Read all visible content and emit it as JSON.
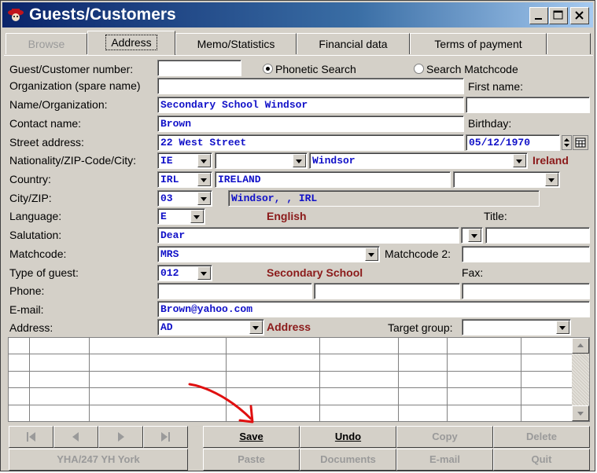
{
  "window": {
    "title": "Guests/Customers"
  },
  "tabs": [
    {
      "label": "Browse",
      "state": "disabled"
    },
    {
      "label": "Address",
      "state": "active"
    },
    {
      "label": "Memo/Statistics",
      "state": "normal"
    },
    {
      "label": "Financial data",
      "state": "normal"
    },
    {
      "label": "Terms of payment",
      "state": "normal"
    }
  ],
  "labels": {
    "guest_number": "Guest/Customer number:",
    "organization_spare": "Organization (spare name)",
    "name_org": "Name/Organization:",
    "contact_name": "Contact name:",
    "street": "Street address:",
    "nationality": "Nationality/ZIP-Code/City:",
    "country": "Country:",
    "city_zip": "City/ZIP:",
    "language": "Language:",
    "salutation": "Salutation:",
    "matchcode": "Matchcode:",
    "type_of_guest": "Type of guest:",
    "phone": "Phone:",
    "email": "E-mail:",
    "address": "Address:",
    "first_name": "First name:",
    "birthday": "Birthday:",
    "title": "Title:",
    "matchcode2": "Matchcode 2:",
    "fax": "Fax:",
    "target_group": "Target group:"
  },
  "search_options": {
    "phonetic": "Phonetic Search",
    "matchcode": "Search Matchcode",
    "selected": "phonetic"
  },
  "fields": {
    "guest_number": "",
    "organization_spare": "",
    "first_name": "",
    "name_org": "Secondary School Windsor",
    "contact_name": "Brown",
    "birthday": "05/12/1970",
    "street": "22 West Street",
    "nationality_code": "IE",
    "zip_code": "",
    "city": "Windsor",
    "nationality_name": "Ireland",
    "country_code": "IRL",
    "country_name": "IRELAND",
    "country_extra": "",
    "city_zip_code": "03",
    "city_zip_display": "Windsor, , IRL",
    "language_code": "E",
    "language_name": "English",
    "title": "",
    "salutation": "Dear",
    "salutation_extra": "",
    "matchcode": "MRS",
    "matchcode2": "",
    "type_of_guest_code": "012",
    "type_of_guest_name": "Secondary School",
    "fax": "",
    "phone1": "",
    "phone2": "",
    "phone3": "",
    "email": "Brown@yahoo.com",
    "address_code": "AD",
    "address_name": "Address",
    "target_group": ""
  },
  "buttons": {
    "save": "Save",
    "undo": "Undo",
    "copy": "Copy",
    "delete": "Delete",
    "paste": "Paste",
    "documents": "Documents",
    "email": "E-mail",
    "quit": "Quit",
    "location": "YHA/247 YH York"
  },
  "colors": {
    "title_bar": "#0a246a",
    "field_text": "#1010c8",
    "label_highlight": "#8b1a1a",
    "annotation_arrow": "#e01010"
  }
}
